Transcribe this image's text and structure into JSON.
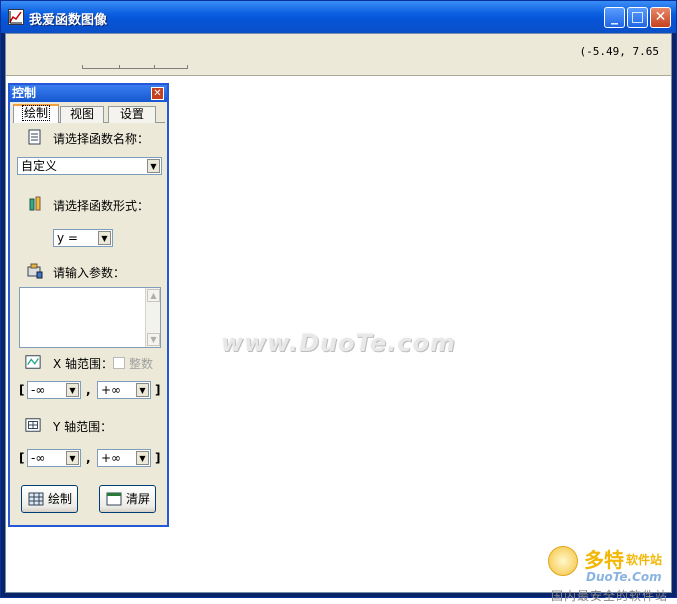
{
  "window": {
    "title": "我爱函数图像",
    "min_glyph": "_",
    "max_glyph": "□",
    "close_glyph": "✕"
  },
  "toolbar": {
    "coord_readout": "(-5.49, 7.65"
  },
  "watermark": {
    "text": "www.DuoTe.com"
  },
  "corner_logo": {
    "brand": "多特",
    "brand_small": "软件站",
    "domain": "DuoTe.Com",
    "slogan": "国内最安全的软件站"
  },
  "panel": {
    "title": "控制",
    "close_glyph": "✕",
    "tabs": [
      {
        "label": "绘制"
      },
      {
        "label": "视图"
      },
      {
        "label": "设置"
      }
    ],
    "function_name_label": "请选择函数名称：",
    "function_name_value": "自定义",
    "function_form_label": "请选择函数形式：",
    "function_form_value": "y =",
    "params_label": "请输入参数：",
    "params_value": "",
    "x_range_label": "X 轴范围：",
    "integer_label": "整数",
    "x_min": "-∞",
    "x_max": "+∞",
    "y_range_label": "Y 轴范围：",
    "y_min": "-∞",
    "y_max": "+∞",
    "bracket_open": "[",
    "bracket_close": "]",
    "comma": ",",
    "draw_button": "绘制",
    "clear_button": "清屏",
    "arrow_glyph": "▼",
    "scroll_up": "▲",
    "scroll_down": "▼"
  }
}
